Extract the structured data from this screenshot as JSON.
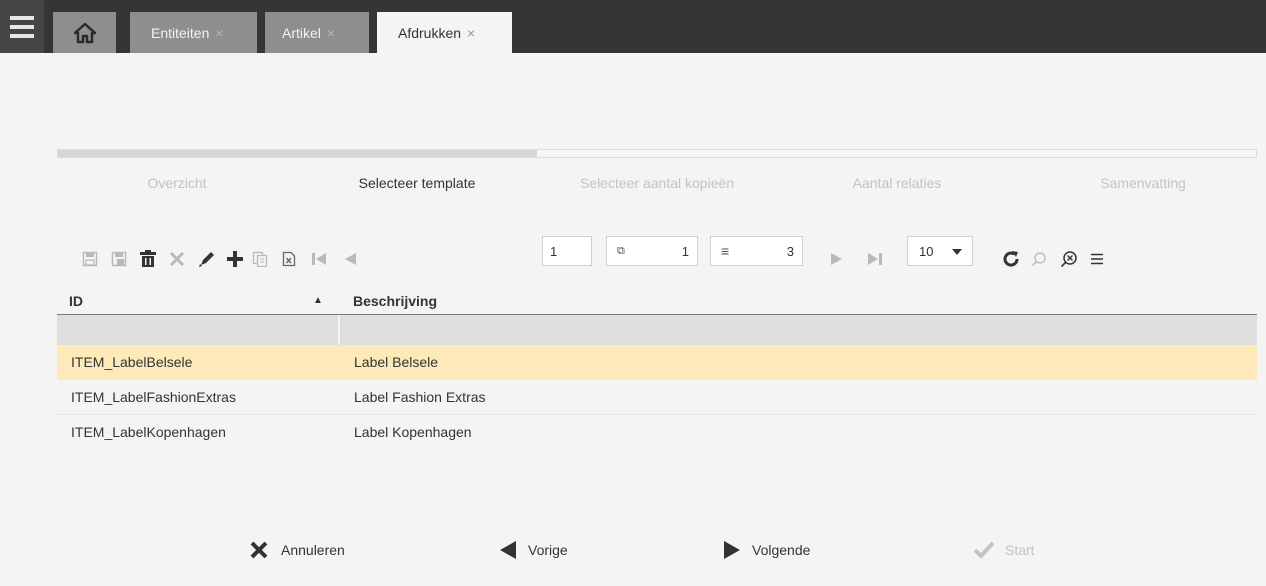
{
  "header": {
    "tabs": [
      {
        "label": "Entiteiten",
        "close": "×"
      },
      {
        "label": "Artikel",
        "close": "×"
      },
      {
        "label": "Afdrukken",
        "close": "×"
      }
    ]
  },
  "wizard": {
    "progress": 0.4,
    "steps": [
      "Overzicht",
      "Selecteer template",
      "Selecteer aantal kopieën",
      "Aantal relaties",
      "Samenvatting"
    ],
    "current_step": 1
  },
  "toolbar": {
    "page_value": "1",
    "page_count": "1",
    "record_count": "3",
    "page_size": "10"
  },
  "grid": {
    "columns": [
      "ID",
      "Beschrijving"
    ],
    "sort": "ascending",
    "rows": [
      {
        "id": "ITEM_LabelBelsele",
        "desc": "Label Belsele"
      },
      {
        "id": "ITEM_LabelFashionExtras",
        "desc": "Label Fashion Extras"
      },
      {
        "id": "ITEM_LabelKopenhagen",
        "desc": "Label Kopenhagen"
      }
    ]
  },
  "footer": {
    "cancel": "Annuleren",
    "prev": "Vorige",
    "next": "Volgende",
    "start": "Start"
  },
  "colors": {
    "topbar": "#353535",
    "tab_inactive": "#8e8e8e",
    "selected_row": "#fdeab8"
  }
}
